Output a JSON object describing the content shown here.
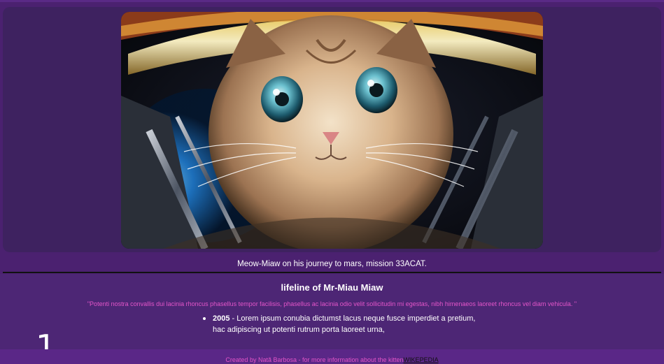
{
  "hero": {
    "image_alt": "Kitten in an astronaut helmet"
  },
  "caption": "Meow-Miaw on his journey to mars, mission 33ACAT.",
  "lifeline": {
    "title": "lifeline of Mr-Miau Miaw",
    "quote": "\"Potenti nostra convallis dui lacinia rhoncus phasellus tempor facilisis, phasellus ac lacinia odio velit sollicitudin mi egestas, nibh himenaeos laoreet rhoncus vel diam vehicula. \"",
    "items": [
      {
        "year": "2005",
        "line1": " - Lorem ipsum conubia dictumst lacus neque fusce imperdiet a pretium,",
        "line2": "hac adipiscing ut potenti rutrum porta laoreet urna,"
      }
    ]
  },
  "page_number": "1",
  "footer": {
    "text": "Created by Natã Barbosa - for more information about the kitten",
    "link_label": "WIKEPEDIA"
  },
  "colors": {
    "background": "#4b2170",
    "panel": "#3e2260",
    "accent_pink": "#e455c9",
    "footer_bg": "#5a2787"
  }
}
